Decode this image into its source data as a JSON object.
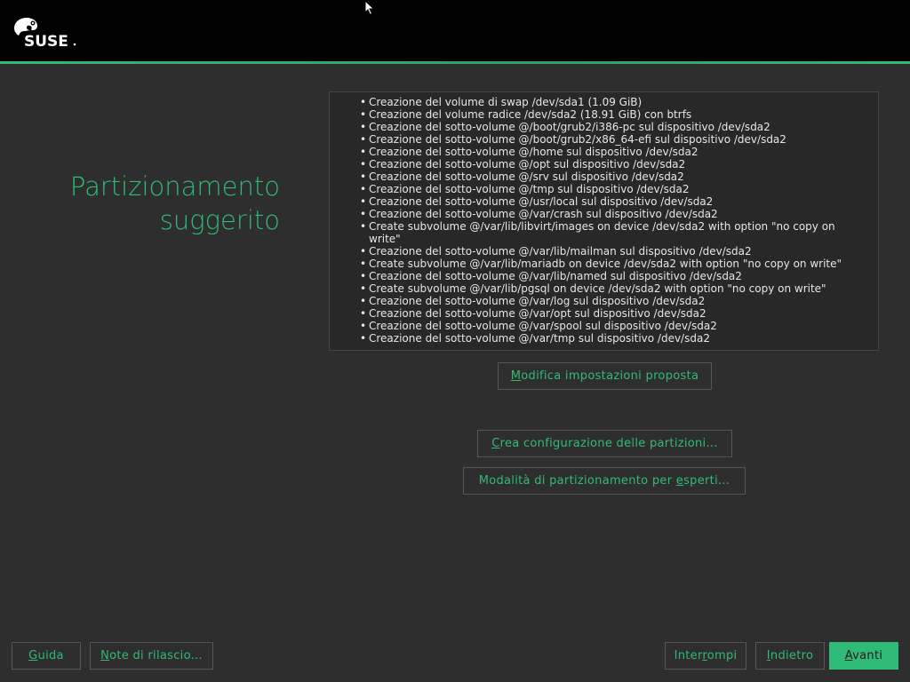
{
  "brand": {
    "logo_text": "SUSE",
    "accent_color": "#30ba78"
  },
  "page_title": "Partizionamento suggerito",
  "proposal": {
    "items": [
      "Creazione del volume di swap /dev/sda1 (1.09 GiB)",
      "Creazione del volume radice /dev/sda2 (18.91 GiB) con btrfs",
      "Creazione del sotto-volume @/boot/grub2/i386-pc sul dispositivo /dev/sda2",
      "Creazione del sotto-volume @/boot/grub2/x86_64-efi sul dispositivo /dev/sda2",
      "Creazione del sotto-volume @/home sul dispositivo /dev/sda2",
      "Creazione del sotto-volume @/opt sul dispositivo /dev/sda2",
      "Creazione del sotto-volume @/srv sul dispositivo /dev/sda2",
      "Creazione del sotto-volume @/tmp sul dispositivo /dev/sda2",
      "Creazione del sotto-volume @/usr/local sul dispositivo /dev/sda2",
      "Creazione del sotto-volume @/var/crash sul dispositivo /dev/sda2",
      "Create subvolume @/var/lib/libvirt/images on device /dev/sda2 with option \"no copy on write\"",
      "Creazione del sotto-volume @/var/lib/mailman sul dispositivo /dev/sda2",
      "Create subvolume @/var/lib/mariadb on device /dev/sda2 with option \"no copy on write\"",
      "Creazione del sotto-volume @/var/lib/named sul dispositivo /dev/sda2",
      "Create subvolume @/var/lib/pgsql on device /dev/sda2 with option \"no copy on write\"",
      "Creazione del sotto-volume @/var/log sul dispositivo /dev/sda2",
      "Creazione del sotto-volume @/var/opt sul dispositivo /dev/sda2",
      "Creazione del sotto-volume @/var/spool sul dispositivo /dev/sda2",
      "Creazione del sotto-volume @/var/tmp sul dispositivo /dev/sda2"
    ]
  },
  "buttons": {
    "edit_proposal": {
      "mnemonic": "M",
      "rest": "odifica impostazioni proposta"
    },
    "create_partition_setup": {
      "mnemonic": "C",
      "rest": "rea configurazione delle partizioni..."
    },
    "expert_partitioner": {
      "before": "Modalità di partizionamento per ",
      "mnemonic": "e",
      "after": "sperti..."
    },
    "help": {
      "mnemonic": "G",
      "rest": "uida"
    },
    "release_notes": {
      "mnemonic": "N",
      "rest": "ote di rilascio..."
    },
    "abort": {
      "before": "Inter",
      "mnemonic": "r",
      "after": "ompi"
    },
    "back": {
      "mnemonic": "I",
      "rest": "ndietro"
    },
    "next": {
      "mnemonic": "A",
      "rest": "vanti"
    }
  }
}
